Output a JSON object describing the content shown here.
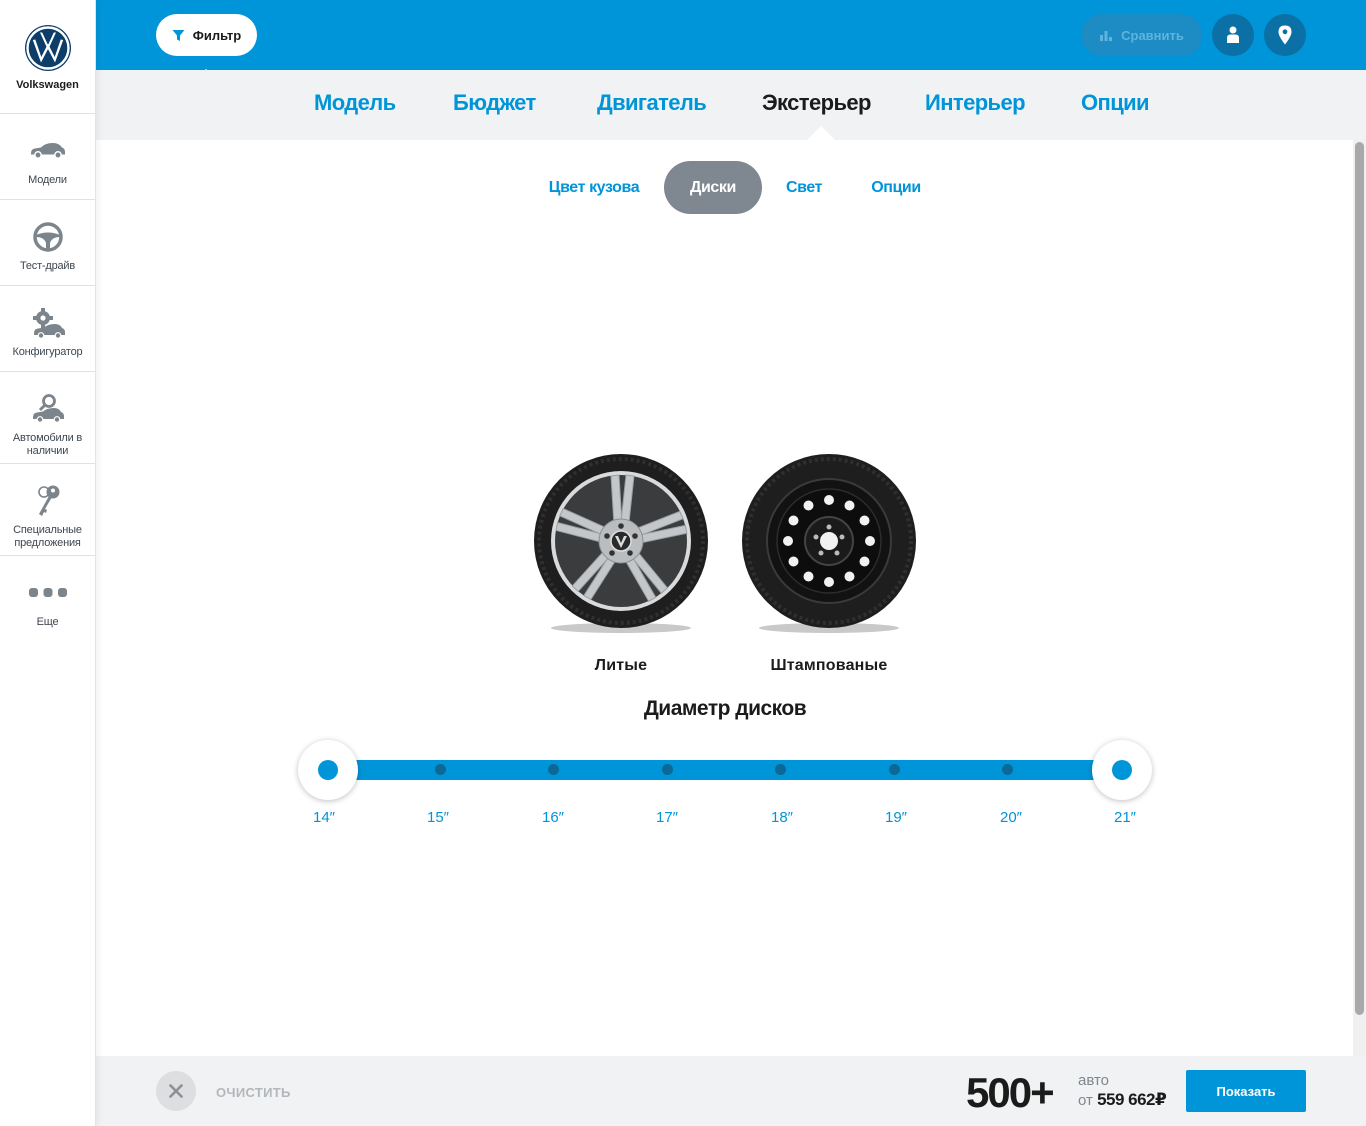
{
  "brand": {
    "name": "Volkswagen"
  },
  "sidebar": {
    "items": [
      {
        "label": "Модели",
        "icon": "car-icon"
      },
      {
        "label": "Тест-драйв",
        "icon": "steering-wheel-icon"
      },
      {
        "label": "Конфигуратор",
        "icon": "configurator-icon"
      },
      {
        "label": "Автомобили в наличии",
        "icon": "car-search-icon"
      },
      {
        "label": "Специальные предложения",
        "icon": "key-icon"
      },
      {
        "label": "Еще",
        "icon": "more-icon"
      }
    ]
  },
  "topbar": {
    "filter_label": "Фильтр",
    "compare_label": "Сравнить"
  },
  "main_tabs": [
    {
      "label": "Модель",
      "active": false
    },
    {
      "label": "Бюджет",
      "active": false
    },
    {
      "label": "Двигатель",
      "active": false
    },
    {
      "label": "Экстерьер",
      "active": true
    },
    {
      "label": "Интерьер",
      "active": false
    },
    {
      "label": "Опции",
      "active": false
    }
  ],
  "sub_tabs": [
    {
      "label": "Цвет кузова",
      "active": false
    },
    {
      "label": "Диски",
      "active": true
    },
    {
      "label": "Свет",
      "active": false
    },
    {
      "label": "Опции",
      "active": false
    }
  ],
  "wheels": [
    {
      "label": "Литые",
      "kind": "alloy"
    },
    {
      "label": "Штампованые",
      "kind": "steel"
    }
  ],
  "diameter": {
    "title": "Диаметр дисков",
    "ticks": [
      "14″",
      "15″",
      "16″",
      "17″",
      "18″",
      "19″",
      "20″",
      "21″"
    ],
    "selected_min": "14″",
    "selected_max": "21″"
  },
  "bottom": {
    "clear_label": "ОЧИСТИТЬ",
    "count": "500+",
    "count_unit": "авто",
    "price_prefix": "от",
    "price": "559 662₽",
    "show_label": "Показать"
  },
  "colors": {
    "accent": "#0095d9",
    "dark": "#1b1b1b",
    "active_subtab": "#7f8790"
  }
}
